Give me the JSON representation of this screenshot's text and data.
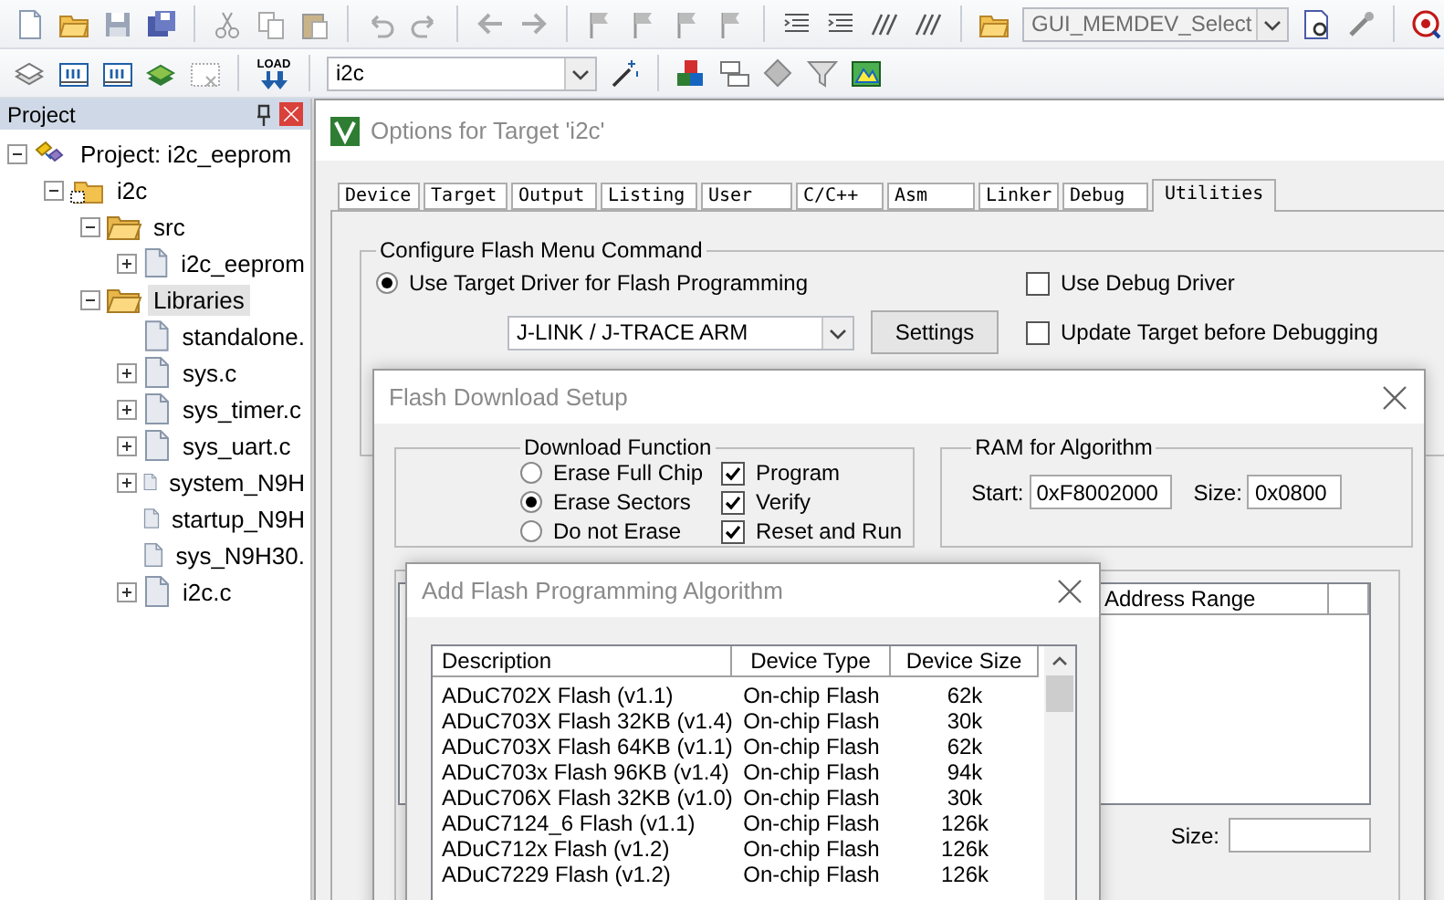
{
  "toolbar": {
    "function_combo": {
      "value": "GUI_MEMDEV_Select",
      "disabled": true
    },
    "load_label": "LOAD",
    "target_combo": {
      "value": "i2c",
      "disabled": false
    }
  },
  "project_panel": {
    "title": "Project",
    "tree": [
      {
        "label": "Project: i2c_eeprom",
        "kind": "project",
        "expanded": true,
        "selected": false,
        "children": [
          {
            "label": "i2c",
            "kind": "target",
            "expanded": true,
            "selected": false,
            "children": [
              {
                "label": "src",
                "kind": "folder",
                "expanded": true,
                "selected": false,
                "children": [
                  {
                    "label": "i2c_eeprom",
                    "kind": "file",
                    "expanded": false,
                    "selected": false
                  }
                ]
              },
              {
                "label": "Libraries",
                "kind": "folder",
                "expanded": true,
                "selected": true,
                "children": [
                  {
                    "label": "standalone.",
                    "kind": "file",
                    "selected": false
                  },
                  {
                    "label": "sys.c",
                    "kind": "file",
                    "expanded": false,
                    "selected": false
                  },
                  {
                    "label": "sys_timer.c",
                    "kind": "file",
                    "expanded": false,
                    "selected": false
                  },
                  {
                    "label": "sys_uart.c",
                    "kind": "file",
                    "expanded": false,
                    "selected": false
                  },
                  {
                    "label": "system_N9H",
                    "kind": "file",
                    "expanded": false,
                    "selected": false
                  },
                  {
                    "label": "startup_N9H",
                    "kind": "file",
                    "selected": false
                  },
                  {
                    "label": "sys_N9H30.",
                    "kind": "file",
                    "selected": false
                  },
                  {
                    "label": "i2c.c",
                    "kind": "file",
                    "expanded": false,
                    "selected": false
                  }
                ]
              }
            ]
          }
        ]
      }
    ]
  },
  "options_dialog": {
    "title": "Options for Target 'i2c'",
    "tabs": [
      {
        "label": "Device",
        "selected": false
      },
      {
        "label": "Target",
        "selected": false
      },
      {
        "label": "Output",
        "selected": false
      },
      {
        "label": "Listing",
        "selected": false
      },
      {
        "label": "User",
        "selected": false
      },
      {
        "label": "C/C++",
        "selected": false
      },
      {
        "label": "Asm",
        "selected": false
      },
      {
        "label": "Linker",
        "selected": false
      },
      {
        "label": "Debug",
        "selected": false
      },
      {
        "label": "Utilities",
        "selected": true
      }
    ],
    "flash_menu_group": {
      "title": "Configure Flash Menu Command",
      "use_target_driver": {
        "label": "Use Target Driver for Flash Programming",
        "selected": true
      },
      "driver_combo": "J-LINK / J-TRACE ARM",
      "settings_button": "Settings",
      "use_debug_driver": {
        "label": "Use Debug Driver",
        "checked": false
      },
      "update_target": {
        "label": "Update Target before Debugging",
        "checked": false
      }
    }
  },
  "flash_setup_dialog": {
    "title": "Flash Download Setup",
    "download_function": {
      "title": "Download Function",
      "erase_options": [
        {
          "label": "Erase Full Chip",
          "selected": false
        },
        {
          "label": "Erase Sectors",
          "selected": true
        },
        {
          "label": "Do not Erase",
          "selected": false
        }
      ],
      "checks": [
        {
          "label": "Program",
          "checked": true
        },
        {
          "label": "Verify",
          "checked": true
        },
        {
          "label": "Reset and Run",
          "checked": true
        }
      ]
    },
    "ram": {
      "title": "RAM for Algorithm",
      "start_label": "Start:",
      "start": "0xF8002000",
      "size_label": "Size:",
      "size": "0x0800"
    },
    "algorithms_table": {
      "visible_column": "Address Range"
    },
    "size_label": "Size:"
  },
  "add_algorithm_dialog": {
    "title": "Add Flash Programming Algorithm",
    "columns": [
      "Description",
      "Device Type",
      "Device Size"
    ],
    "rows": [
      {
        "description": "ADuC702X Flash (v1.1)",
        "device_type": "On-chip Flash",
        "device_size": "62k"
      },
      {
        "description": "ADuC703X Flash 32KB (v1.4)",
        "device_type": "On-chip Flash",
        "device_size": "30k"
      },
      {
        "description": "ADuC703X Flash 64KB (v1.1)",
        "device_type": "On-chip Flash",
        "device_size": "62k"
      },
      {
        "description": "ADuC703x Flash 96KB (v1.4)",
        "device_type": "On-chip Flash",
        "device_size": "94k"
      },
      {
        "description": "ADuC706X Flash 32KB (v1.0)",
        "device_type": "On-chip Flash",
        "device_size": "30k"
      },
      {
        "description": "ADuC7124_6 Flash (v1.1)",
        "device_type": "On-chip Flash",
        "device_size": "126k"
      },
      {
        "description": "ADuC712x Flash (v1.2)",
        "device_type": "On-chip Flash",
        "device_size": "126k"
      },
      {
        "description": "ADuC7229 Flash (v1.2)",
        "device_type": "On-chip Flash",
        "device_size": "126k"
      }
    ]
  }
}
